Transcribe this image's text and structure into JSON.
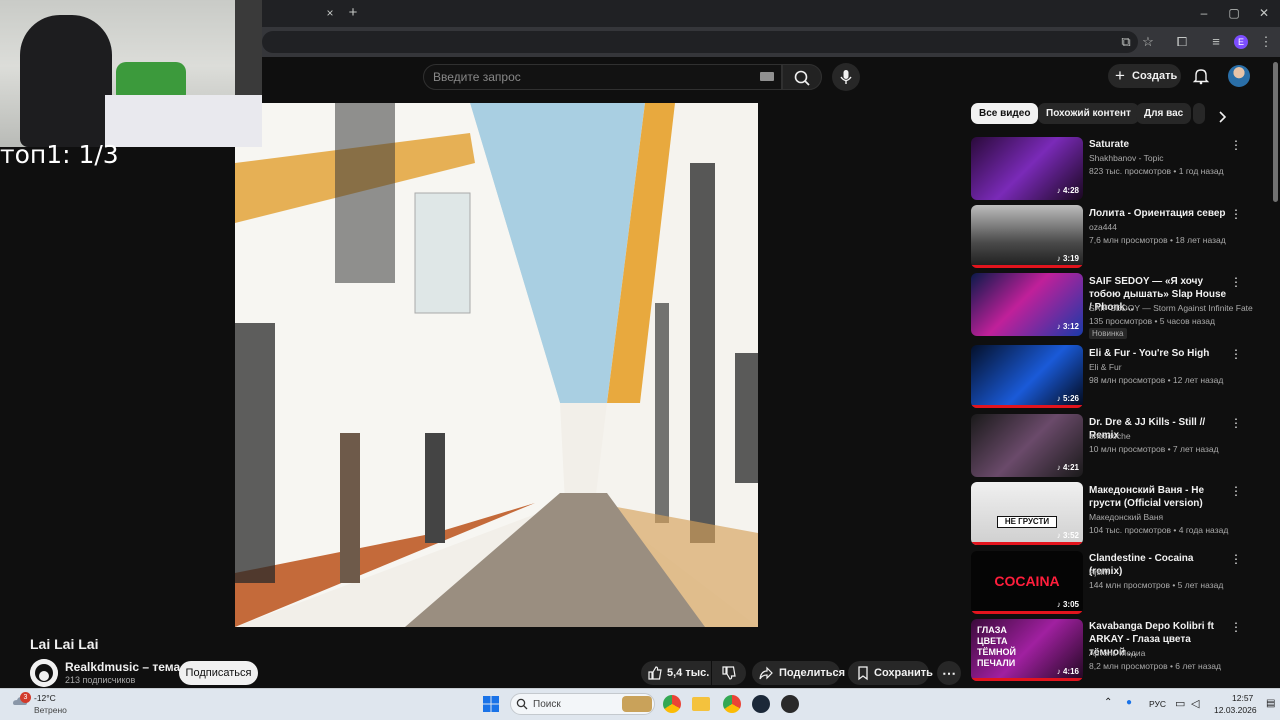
{
  "browser": {
    "tab_close": "×",
    "tab_new": "+",
    "win_min": "–",
    "win_max": "▢",
    "win_close": "✕",
    "profile_letter": "E"
  },
  "header": {
    "search_placeholder": "Введите запрос",
    "create_label": "Создать"
  },
  "overlay": {
    "top_label": "топ1: 1/3"
  },
  "video": {
    "title": "Lai Lai Lai",
    "channel_name": "Realkdmusic – тема",
    "subscribers": "213 подписчиков",
    "subscribe_label": "Подписаться",
    "likes": "5,4 тыс.",
    "share_label": "Поделиться",
    "save_label": "Сохранить"
  },
  "sidebar": {
    "chips": [
      "Все видео",
      "Похожий контент",
      "Для вас"
    ],
    "items": [
      {
        "title": "Saturate",
        "channel": "Shakhbanov - Topic",
        "meta": "823 тыс. просмотров • 1 год назад",
        "duration": "4:28"
      },
      {
        "title": "Лолита - Ориентация север",
        "channel": "oza444",
        "meta": "7,6 млн просмотров • 18 лет назад",
        "duration": "3:19"
      },
      {
        "title": "SAIF SEDOY — «Я хочу тобою дышать» Slap House / Phonk...",
        "channel": "SAIF SEDOY — Storm Against Infinite Fate",
        "meta": "135 просмотров • 5 часов назад",
        "duration": "3:12",
        "badge": "Новинка"
      },
      {
        "title": "Eli & Fur - You're So High",
        "channel": "Eli & Fur",
        "meta": "98 млн просмотров • 12 лет назад",
        "duration": "5:26"
      },
      {
        "title": "Dr. Dre & JJ Kills - Still // Remix",
        "channel": "anecdoche",
        "meta": "10 млн просмотров • 7 лет назад",
        "duration": "4:21"
      },
      {
        "title": "Македонский Ваня - Не грусти (Official version)",
        "channel": "Македонский Ваня",
        "meta": "104 тыс. просмотров • 4 года назад",
        "duration": "3:52",
        "thumb_text": "НЕ ГРУСТИ"
      },
      {
        "title": "Clandestine - Cocaina (remix)",
        "channel": "AjsiM",
        "meta": "144 млн просмотров • 5 лет назад",
        "duration": "3:05",
        "thumb_text": "COCAINA"
      },
      {
        "title": "Kavabanga Depo Kolibri ft ARKAY - Глаза цвета тёмной ...",
        "channel": "Артель Медиа",
        "meta": "8,2 млн просмотров • 6 лет назад",
        "duration": "4:16",
        "thumb_text": "ГЛАЗА ЦВЕТА ТЁМНОЙ ПЕЧАЛИ"
      }
    ]
  },
  "taskbar": {
    "weather_badge": "3",
    "temperature": "-12°C",
    "weather_text": "Ветрено",
    "search_label": "Поиск",
    "language": "РУС",
    "time": "12:57",
    "date": "12.03.2026"
  },
  "colors": {
    "background": "#0f0f0f",
    "accent_red": "#e2141d",
    "chip_active": "#f1f1f1"
  }
}
